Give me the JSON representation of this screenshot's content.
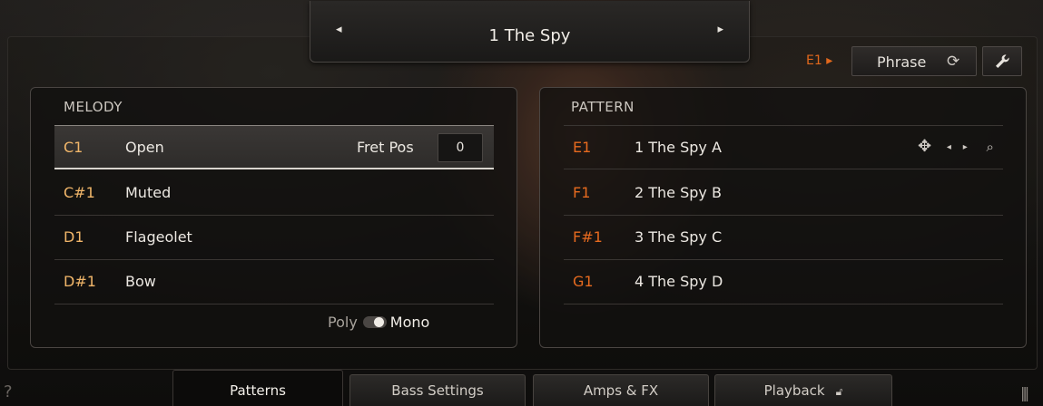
{
  "preset": {
    "prev_arrow": "◂",
    "next_arrow": "▸",
    "name": "1  The Spy"
  },
  "header": {
    "key_indicator": "E1 ▸",
    "phrase_label": "Phrase",
    "phrase_icon": "⟳",
    "accent_color": "#e2681c"
  },
  "melody": {
    "title": "MELODY",
    "rows": [
      {
        "note": "C1",
        "label": "Open"
      },
      {
        "note": "C#1",
        "label": "Muted"
      },
      {
        "note": "D1",
        "label": "Flageolet"
      },
      {
        "note": "D#1",
        "label": "Bow"
      }
    ],
    "fret_pos_label": "Fret Pos",
    "fret_pos_value": "0",
    "poly_label": "Poly",
    "mono_label": "Mono"
  },
  "pattern": {
    "title": "PATTERN",
    "rows": [
      {
        "note": "E1",
        "label": "1  The Spy A"
      },
      {
        "note": "F1",
        "label": "2  The Spy B"
      },
      {
        "note": "F#1",
        "label": "3  The Spy C"
      },
      {
        "note": "G1",
        "label": "4  The Spy D"
      }
    ],
    "tools": {
      "move": "✥",
      "left": "◂",
      "right": "▸",
      "search": "⌕"
    }
  },
  "footer": {
    "help": "?",
    "tabs": [
      {
        "label": "Patterns"
      },
      {
        "label": "Bass Settings"
      },
      {
        "label": "Amps & FX"
      },
      {
        "label": "Playback"
      }
    ],
    "lock_icon": "🔓︎",
    "keys_icon": "|||"
  }
}
